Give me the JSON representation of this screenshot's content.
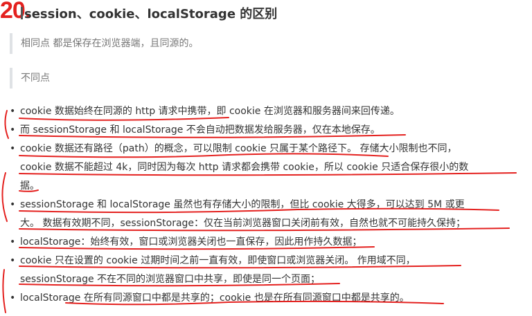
{
  "annotation_number": "20.",
  "title": "session、cookie、localStorage 的区别",
  "blockquotes": [
    "相同点 都是保存在浏览器端，且同源的。",
    "不同点"
  ],
  "list": [
    {
      "lines": [
        "cookie 数据始终在同源的 http 请求中携带，即 cookie 在浏览器和服务器间来回传递。"
      ]
    },
    {
      "lines": [
        "而 sessionStorage 和 localStorage 不会自动把数据发给服务器，仅在本地保存。"
      ]
    },
    {
      "lines": [
        "cookie 数据还有路径（path）的概念，可以限制 cookie 只属于某个路径下。 存储大小限制也不同，",
        "cookie 数据不能超过 4k，同时因为每次 http 请求都会携带 cookie，所以 cookie 只适合保存很小的数",
        "据。"
      ]
    },
    {
      "lines": [
        "sessionStorage 和 localStorage 虽然也有存储大小的限制，但比 cookie 大得多，可以达到 5M 或更",
        "大。 数据有效期不同，sessionStorage：仅在当前浏览器窗口关闭前有效，自然也就不可能持久保持；"
      ]
    },
    {
      "lines": [
        "localStorage：始终有效，窗口或浏览器关闭也一直保存，因此用作持久数据；"
      ]
    },
    {
      "lines": [
        "cookie 只在设置的 cookie 过期时间之前一直有效，即使窗口或浏览器关闭。 作用域不同，",
        "sessionStorage 不在不同的浏览器窗口中共享，即使是同一个页面；"
      ]
    },
    {
      "lines": [
        "localStorage 在所有同源窗口中都是共享的；cookie 也是在所有同源窗口中都是共享的。"
      ]
    }
  ],
  "colors": {
    "annotation": "#e4211f",
    "text": "#333333",
    "quote_text": "#777777",
    "quote_border": "#dfe2e5"
  }
}
